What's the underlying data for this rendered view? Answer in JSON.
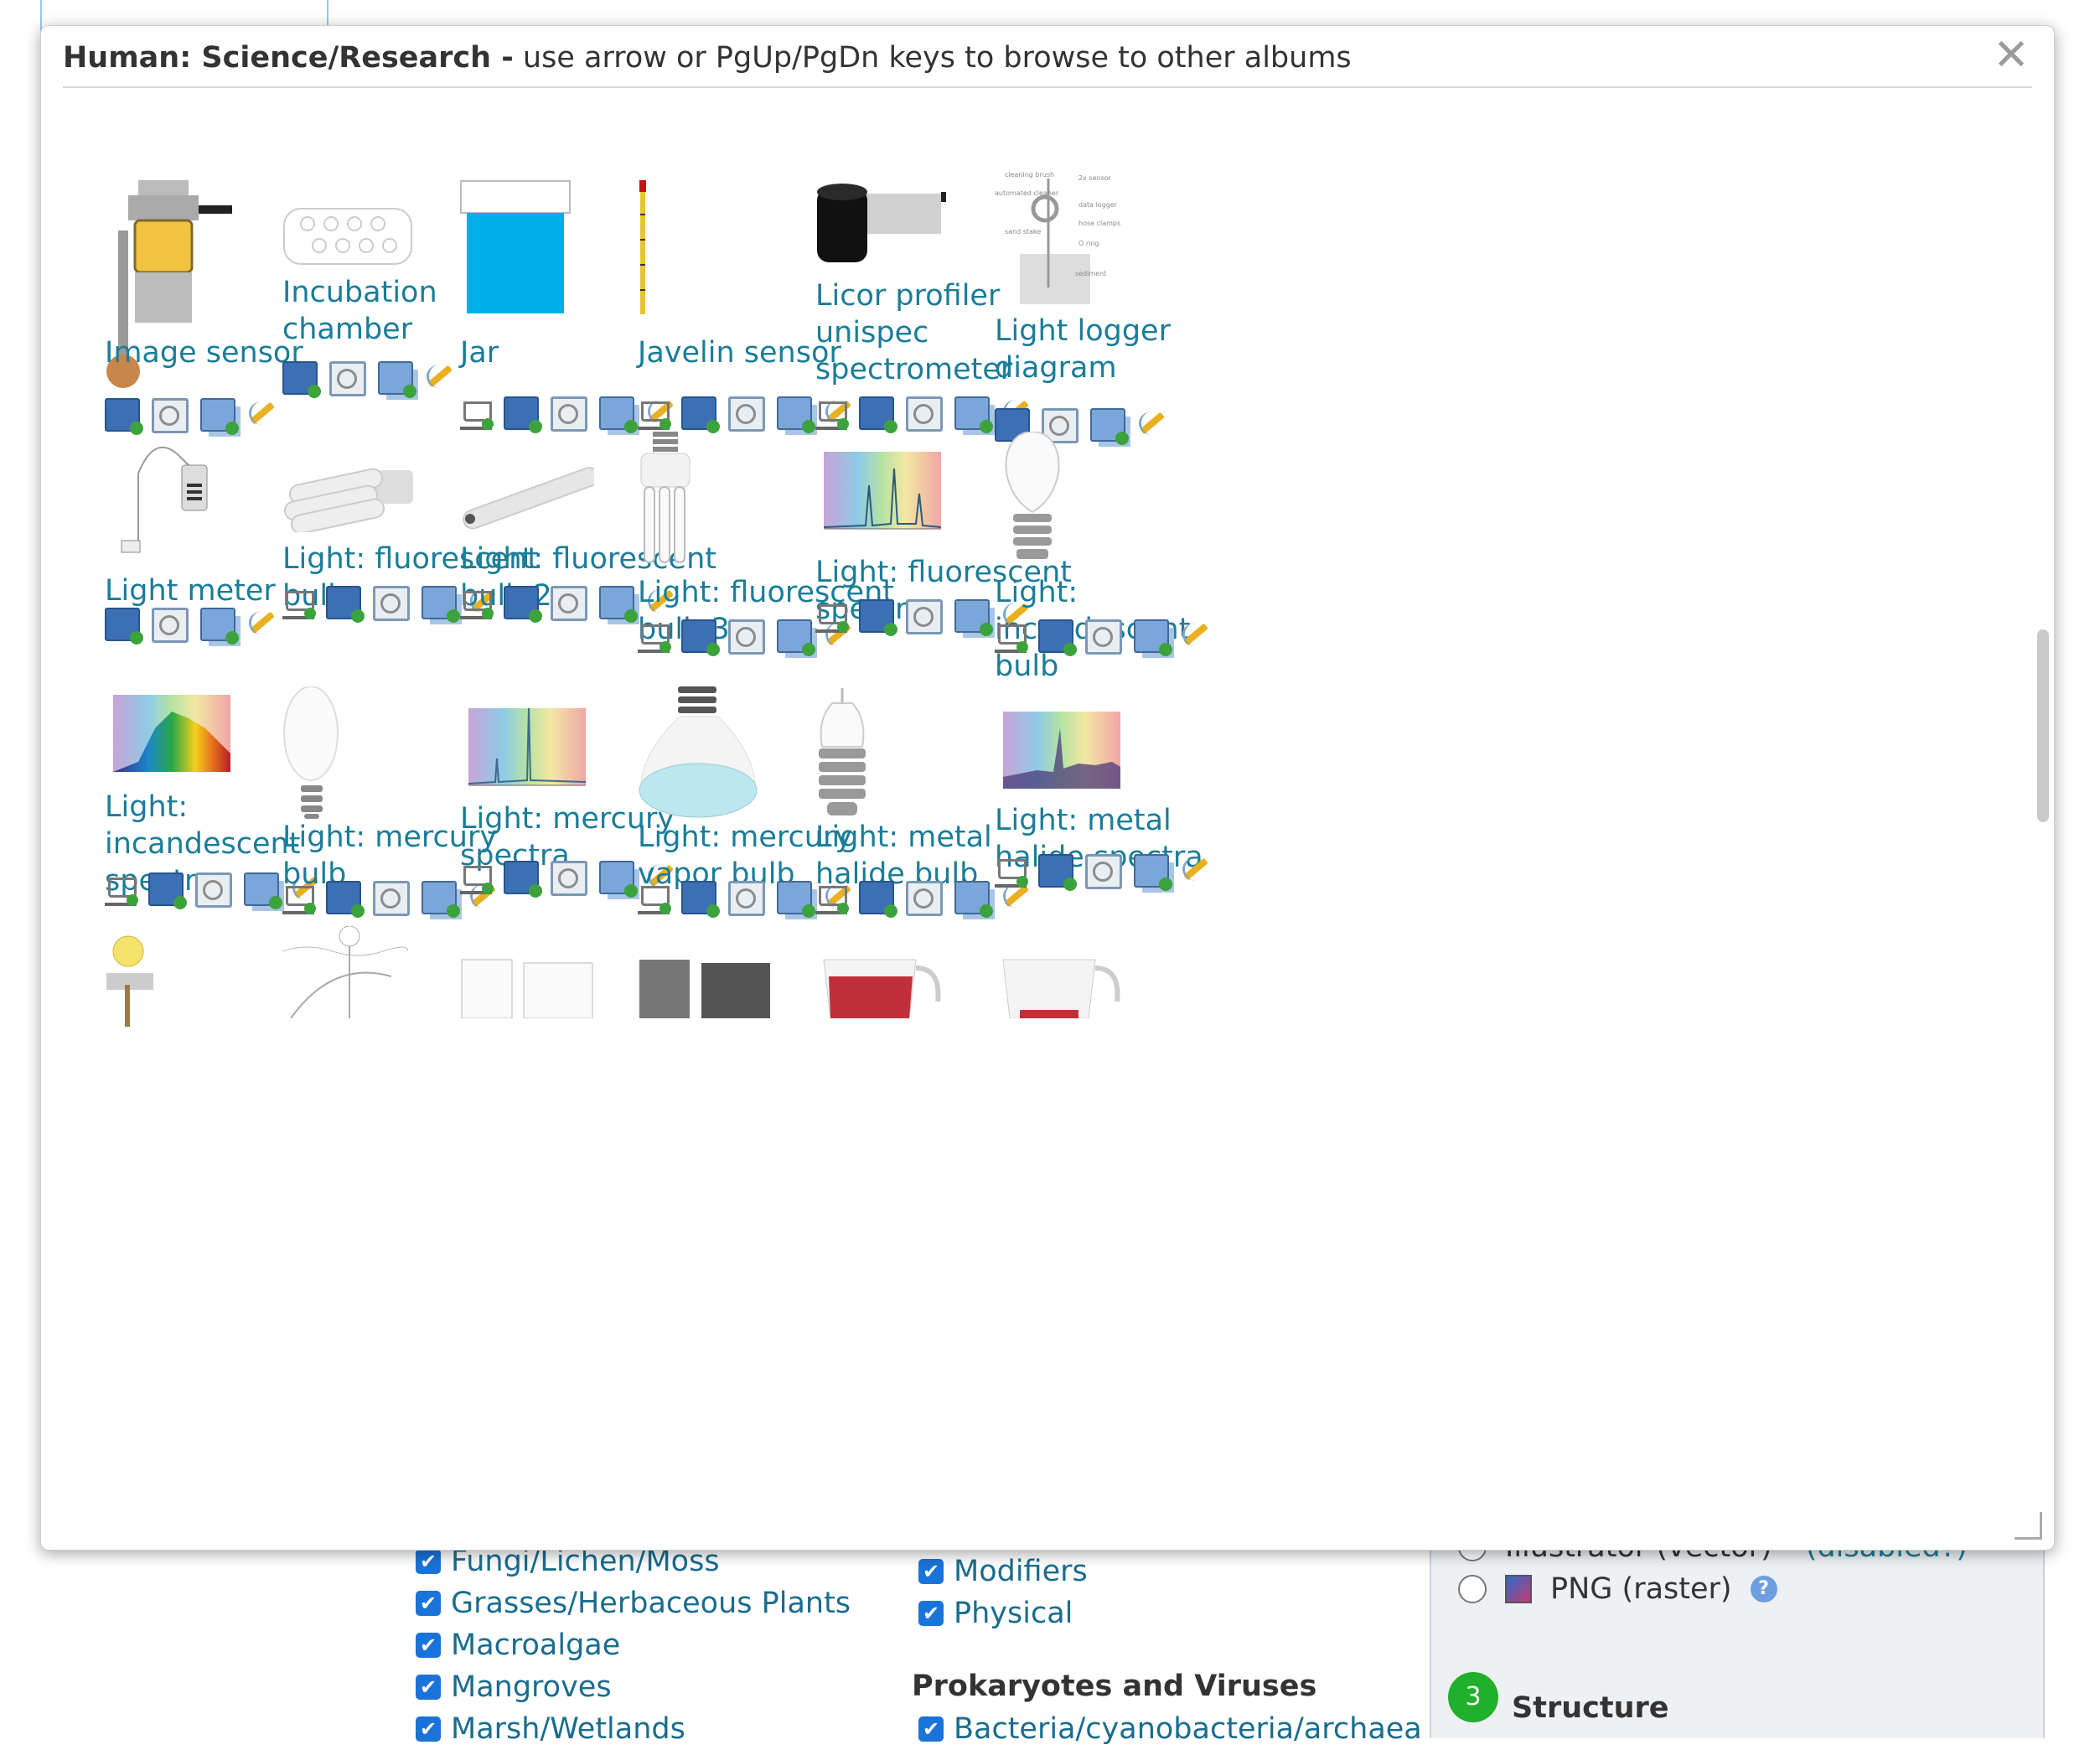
{
  "dialog": {
    "title_bold": "Human: Science/Research -",
    "title_rest": " use arrow or PgUp/PgDn keys to browse to other albums",
    "close_label": "✕"
  },
  "items": [
    {
      "title": "Image sensor",
      "actions": [
        "add",
        "view",
        "copy",
        "edit"
      ]
    },
    {
      "title": "Incubation chamber",
      "actions": [
        "add",
        "view",
        "copy",
        "edit"
      ]
    },
    {
      "title": "Jar",
      "actions": [
        "cart",
        "add",
        "view",
        "copy",
        "edit"
      ]
    },
    {
      "title": "Javelin sensor",
      "actions": [
        "cart",
        "add",
        "view",
        "copy",
        "edit"
      ]
    },
    {
      "title": "Licor profiler unispec spectrometer",
      "actions": [
        "cart",
        "add",
        "view",
        "copy",
        "edit"
      ]
    },
    {
      "title": "Light logger diagram",
      "actions": [
        "add",
        "view",
        "copy",
        "edit"
      ]
    },
    {
      "title": "Light meter",
      "actions": [
        "add",
        "view",
        "copy",
        "edit"
      ]
    },
    {
      "title": "Light: fluorescent bulb",
      "actions": [
        "cart",
        "add",
        "view",
        "copy",
        "edit"
      ]
    },
    {
      "title": "Light: fluorescent bulb 2",
      "actions": [
        "cart",
        "add",
        "view",
        "copy",
        "edit"
      ]
    },
    {
      "title": "Light: fluorescent bulb 3",
      "actions": [
        "cart",
        "add",
        "view",
        "copy",
        "edit"
      ]
    },
    {
      "title": "Light: fluorescent spectra",
      "actions": [
        "cart",
        "add",
        "view",
        "copy",
        "edit"
      ]
    },
    {
      "title": "Light: incandescent bulb",
      "actions": [
        "cart",
        "add",
        "view",
        "copy",
        "edit"
      ]
    },
    {
      "title": "Light: incandescent spectra",
      "actions": [
        "cart",
        "add",
        "view",
        "copy",
        "edit"
      ]
    },
    {
      "title": "Light: mercury bulb",
      "actions": [
        "cart",
        "add",
        "view",
        "copy",
        "edit"
      ]
    },
    {
      "title": "Light: mercury spectra",
      "actions": [
        "cart",
        "add",
        "view",
        "copy",
        "edit"
      ]
    },
    {
      "title": "Light: mercury vapor bulb",
      "actions": [
        "cart",
        "add",
        "view",
        "copy",
        "edit"
      ]
    },
    {
      "title": "Light: metal halide bulb",
      "actions": [
        "cart",
        "add",
        "view",
        "copy",
        "edit"
      ]
    },
    {
      "title": "Light: metal halide spectra",
      "actions": [
        "cart",
        "add",
        "view",
        "copy",
        "edit"
      ]
    }
  ],
  "background": {
    "list_left": [
      "Fungi/Lichen/Moss",
      "Grasses/Herbaceous Plants",
      "Macroalgae",
      "Mangroves",
      "Marsh/Wetlands"
    ],
    "list_mid": [
      "Modifiers",
      "Physical"
    ],
    "heading_prokaryotes": "Prokaryotes and Viruses",
    "list_mid2": [
      "Bacteria/cyanobacteria/archaea"
    ],
    "radio_partial": "Illustrator (vector)",
    "radio_partial_note": "(disabled?)",
    "radio_png": "PNG (raster)",
    "step_number": "3",
    "step_label": "Structure"
  }
}
